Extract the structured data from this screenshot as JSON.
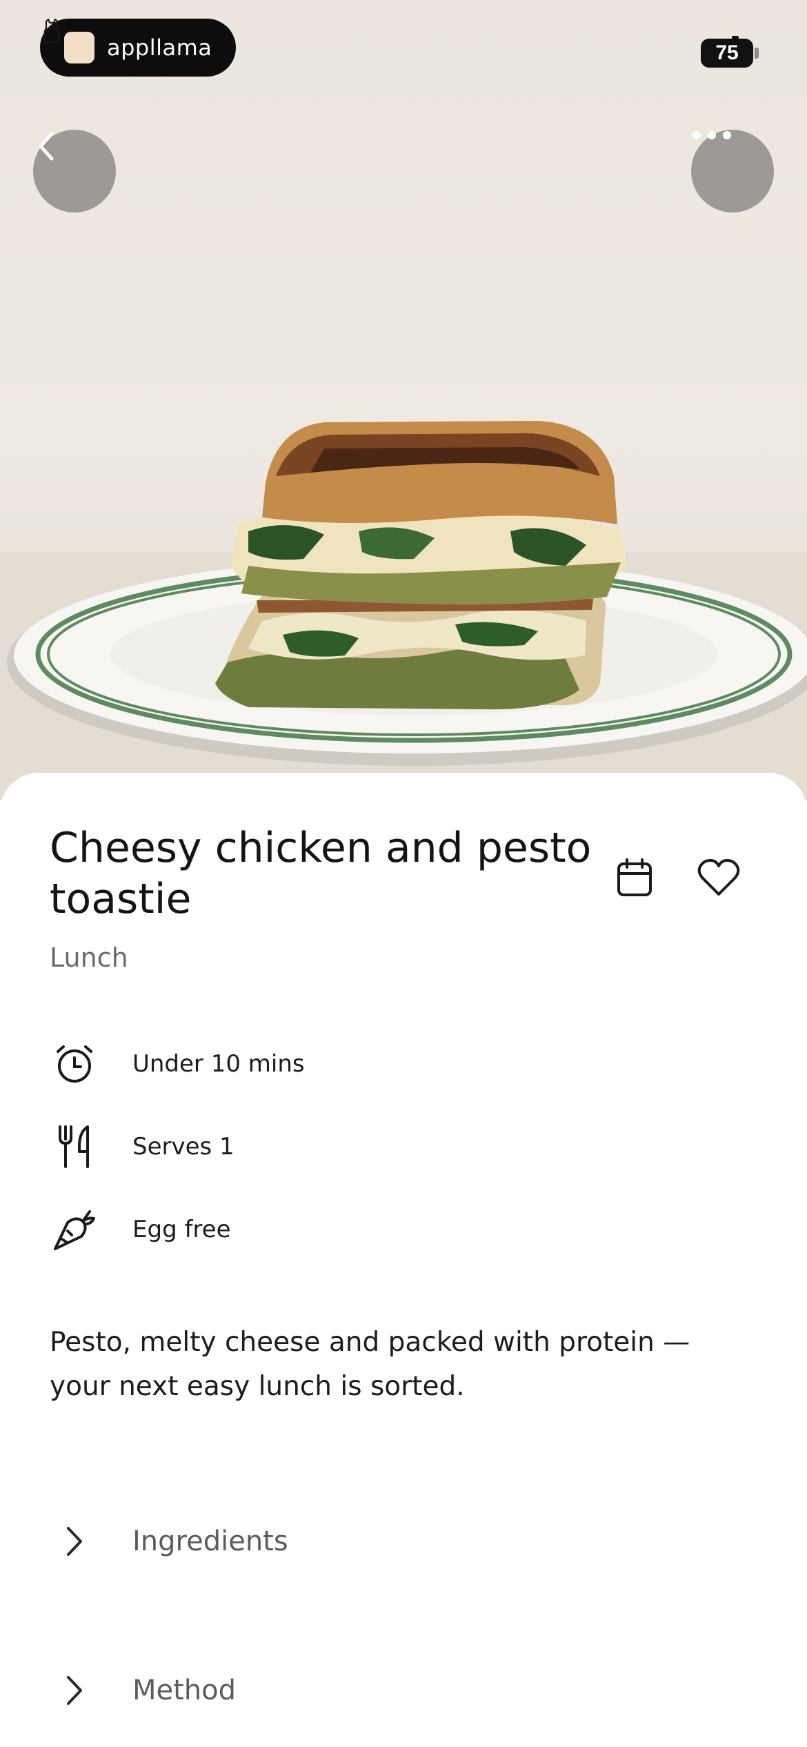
{
  "status_bar": {
    "app_name": "appllama",
    "battery_level": "75",
    "icons": [
      "signal-icon",
      "wifi-icon",
      "battery-icon"
    ]
  },
  "header": {
    "back_icon": "chevron-left-icon",
    "more_icon": "more-horizontal-icon"
  },
  "recipe": {
    "title": "Cheesy chicken and pesto toastie",
    "category": "Lunch",
    "actions": [
      "calendar-icon",
      "heart-icon"
    ],
    "meta": [
      {
        "icon": "alarm-clock-icon",
        "text": "Under 10 mins"
      },
      {
        "icon": "cutlery-icon",
        "text": "Serves 1"
      },
      {
        "icon": "carrot-icon",
        "text": "Egg free"
      }
    ],
    "description": "Pesto, melty cheese and packed with protein — your next easy lunch is sorted.",
    "sections": [
      {
        "label": "Ingredients",
        "icon": "chevron-right-icon"
      },
      {
        "label": "Method",
        "icon": "chevron-right-icon"
      }
    ]
  },
  "colors": {
    "background": "#ffffff",
    "hero_wall": "#ece6df",
    "plate_stripe": "#5e8a62",
    "button_overlay": "#807c78",
    "text_primary": "#141414",
    "text_secondary": "#6a6a6a"
  }
}
